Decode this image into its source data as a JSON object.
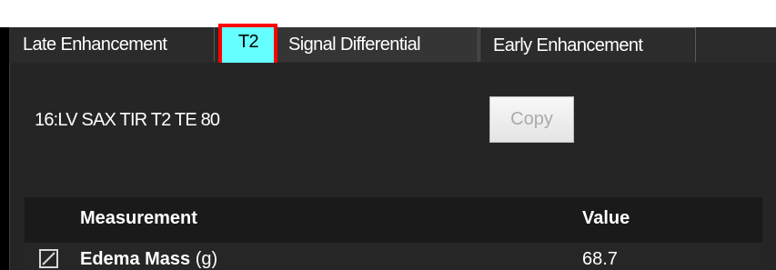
{
  "tabs": {
    "late_enhancement": "Late Enhancement",
    "t2": "T2",
    "signal_differential": "Signal Differential",
    "early_enhancement": "Early Enhancement"
  },
  "series": {
    "label": "16:LV SAX TIR T2 TE 80"
  },
  "copy_button": {
    "label": "Copy"
  },
  "table": {
    "headers": {
      "measurement": "Measurement",
      "value": "Value"
    },
    "rows": [
      {
        "checked": true,
        "name": "Edema Mass",
        "unit": "(g)",
        "value": "68.7"
      }
    ]
  },
  "colors": {
    "highlight_fill": "#66ffff",
    "highlight_border": "#ff0000",
    "panel_background": "#252525"
  }
}
